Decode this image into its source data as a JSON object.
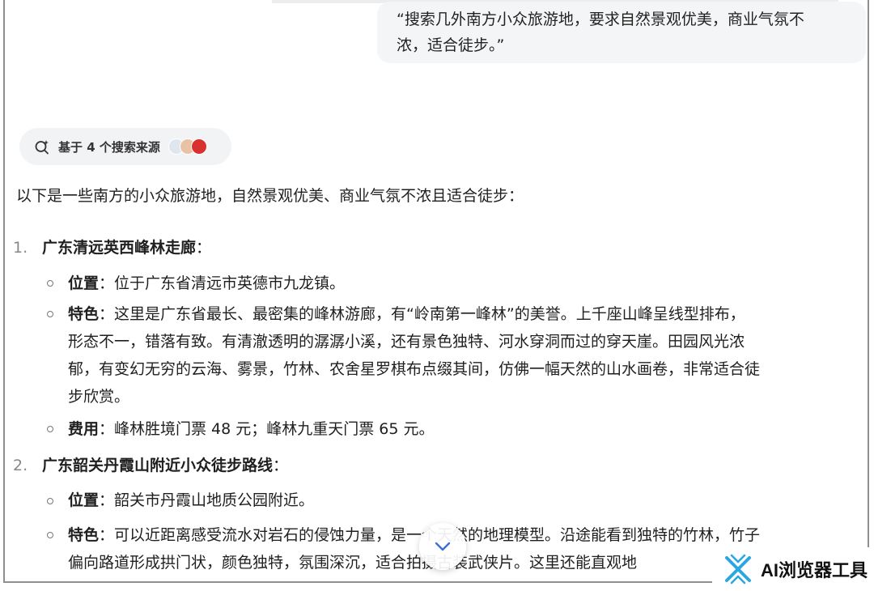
{
  "user_message": {
    "line1": "“搜索几外南方小众旅游地，要求自然景观优美，商业气氛不",
    "line2": "浓，适合徒步。”"
  },
  "sources": {
    "label": "基于 4 个搜索来源"
  },
  "answer": {
    "intro": "以下是一些南方的小众旅游地，自然景观优美、商业气氛不浓且适合徒步：",
    "items": [
      {
        "number": "1.",
        "title": "广东清远英西峰林走廊",
        "colon": "：",
        "details": [
          {
            "label": "位置",
            "lines": [
              "：位于广东省清远市英德市九龙镇。"
            ]
          },
          {
            "label": "特色",
            "lines": [
              "：这里是广东省最长、最密集的峰林游廊，有“岭南第一峰林”的美誉。上千座山峰呈线型排布，",
              "形态不一，错落有致。有清澈透明的潺潺小溪，还有景色独特、河水穿洞而过的穿天崖。田园风光浓",
              "郁，有变幻无穷的云海、雾景，竹林、农舍星罗棋布点缀其间，仿佛一幅天然的山水画卷，非常适合徒",
              "步欣赏。"
            ]
          },
          {
            "label": "费用",
            "lines": [
              "：峰林胜境门票 48 元；峰林九重天门票 65 元。"
            ]
          }
        ]
      },
      {
        "number": "2.",
        "title": "广东韶关丹霞山附近小众徒步路线",
        "colon": "：",
        "details": [
          {
            "label": "位置",
            "lines": [
              "：韶关市丹霞山地质公园附近。"
            ]
          },
          {
            "label": "特色",
            "lines": [
              "：可以近距离感受流水对岩石的侵蚀力量，是一个天然的地理模型。沿途能看到独特的竹林，竹子",
              "偏向路道形成拱门状，颜色独特，氛围深沉，适合拍摄古装武侠片。这里还能直观地"
            ]
          }
        ]
      }
    ]
  },
  "watermark": {
    "text": "AI浏览器工具",
    "color": "#2aa7e0"
  }
}
